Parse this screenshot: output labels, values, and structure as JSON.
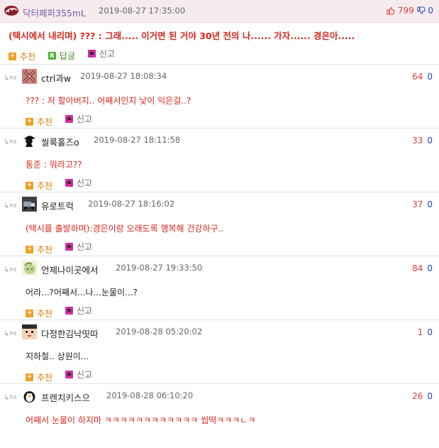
{
  "post": {
    "author": "닥터페퍼355mL",
    "date": "2019-08-27 17:35:00",
    "upvotes": "799",
    "downvotes": "0",
    "title": "(택시에서 내리며) ??? : 그래..... 이거면 된 거야 30년 전의 나...... 가자...... 경은아.....",
    "actions": {
      "recommend": "추천",
      "reply": "답글",
      "report": "신고"
    }
  },
  "comment_labels": {
    "re": "RE",
    "recommend": "추천",
    "report": "신고"
  },
  "comments": [
    {
      "name": "ctrl과w",
      "date": "2019-08-27 18:08:34",
      "up": "64",
      "down": "0",
      "text": "??? : 저 할아버지.. 어째서인지 낯이 익은걸..?",
      "avatar": "x-avatar-icon"
    },
    {
      "name": "씰룩홀즈o",
      "date": "2019-08-27 18:11:58",
      "up": "33",
      "down": "0",
      "text": "통준 : 뭐라고??",
      "avatar": "detective-silhouette-icon"
    },
    {
      "name": "유로트럭",
      "date": "2019-08-27 18:16:02",
      "up": "37",
      "down": "0",
      "text": "(택시를 출발하며):경은이랑 오래도록 행복해 건강하구..",
      "avatar": "truck-avatar-icon"
    },
    {
      "name": "언제나이곳에서",
      "date": "2019-08-27 19:33:50",
      "up": "84",
      "down": "0",
      "text": "어라...?어째서...나...눈물이...?",
      "avatar": "green-character-avatar-icon"
    },
    {
      "name": "다정한김낙띳따",
      "date": "2019-08-28 05:20:02",
      "up": "1",
      "down": "0",
      "text": "지하철.. 상원이...",
      "avatar": "pixel-face-avatar-icon"
    },
    {
      "name": "프렌치키스으",
      "date": "2019-08-28 06:10:20",
      "up": "26",
      "down": "0",
      "text": "어째서 눈물이 하지마 ㅋㅋㅋㅋㅋㅋㅋㅋㅋㅋㅋㅋ 씹떡ㅋㅋㅋㄴㅋ",
      "avatar": "penguin-avatar-icon"
    }
  ],
  "colors": {
    "header_bg": "#f6ecee",
    "author_purple": "#7b5aa6",
    "title_red": "#d6281e",
    "upvote_red": "#e03c3c",
    "downvote_blue": "#2a47c9",
    "recommend_orange": "#f0a022",
    "reply_green": "#56b13a",
    "report_pink": "#cf2e9c"
  }
}
